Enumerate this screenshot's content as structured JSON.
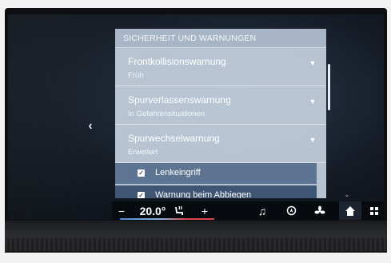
{
  "panel": {
    "header": "SICHERHEIT UND WARNUNGEN",
    "items": [
      {
        "title": "Frontkollisionswarnung",
        "value": "Früh"
      },
      {
        "title": "Spurverlassenswarnung",
        "value": "In Gefahrensituationen"
      },
      {
        "title": "Spurwechselwarnung",
        "value": "Erweitert"
      }
    ],
    "checks": [
      {
        "label": "Lenkeingriff",
        "checked": true
      },
      {
        "label": "Warnung beim Abbiegen",
        "checked": true
      }
    ]
  },
  "climate": {
    "minus": "−",
    "temperature": "20.0°",
    "plus": "+"
  },
  "icons": {
    "back": "chevron-left-icon",
    "seat_heat": "seat-heating-icon",
    "music": "music-icon",
    "navigation": "navigation-icon",
    "fan": "fan-icon",
    "home": "home-icon",
    "apps": "apps-grid-icon"
  },
  "colors": {
    "panel": "#c4d0de",
    "selected_row": "#5d7592",
    "accent_cold": "#4a8ad6",
    "accent_warm": "#d8454a"
  }
}
